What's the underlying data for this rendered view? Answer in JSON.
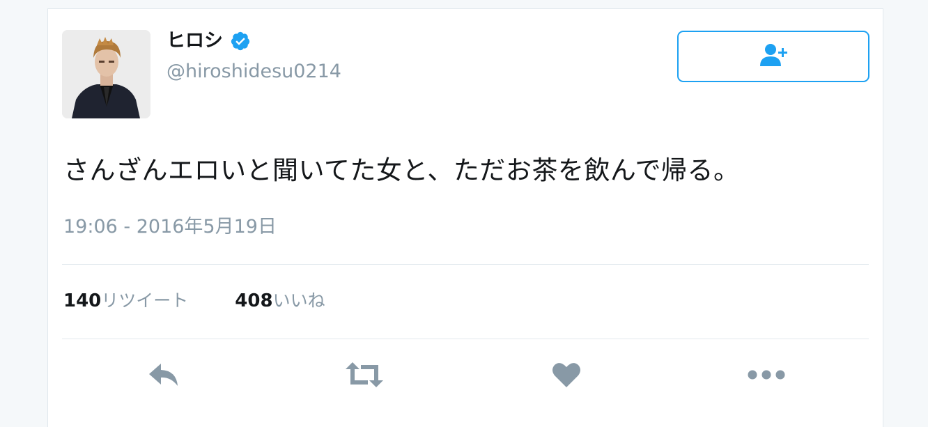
{
  "user": {
    "display_name": "ヒロシ",
    "handle": "@hiroshidesu0214",
    "verified": true
  },
  "tweet": {
    "text": "さんざんエロいと聞いてた女と、ただお茶を飲んで帰る。",
    "timestamp": "19:06 - 2016年5月19日"
  },
  "stats": {
    "retweets_count": "140",
    "retweets_label": "リツイート",
    "likes_count": "408",
    "likes_label": "いいね"
  },
  "icons": {
    "verified": "verified-badge-icon",
    "follow": "add-user-icon",
    "reply": "reply-icon",
    "retweet": "retweet-icon",
    "like": "heart-icon",
    "more": "more-icon"
  },
  "colors": {
    "accent": "#1da1f2",
    "muted": "#8899a6",
    "text": "#14171a",
    "icon_gray": "#8899a6"
  }
}
